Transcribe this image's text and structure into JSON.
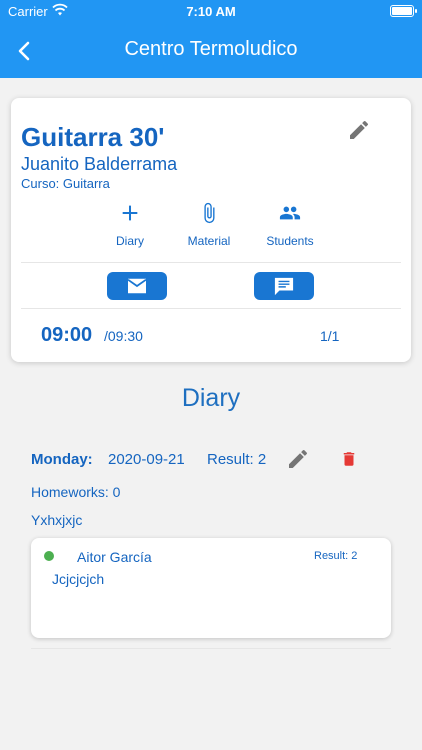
{
  "status_bar": {
    "carrier": "Carrier",
    "time": "7:10 AM"
  },
  "app_bar": {
    "title": "Centro Termoludico",
    "back_icon": "arrow-back-icon"
  },
  "class_card": {
    "title": "Guitarra 30'",
    "teacher": "Juanito Balderrama",
    "course": "Curso: Guitarra",
    "actions": [
      {
        "label": "Diary",
        "icon": "add-icon"
      },
      {
        "label": "Material",
        "icon": "paperclip-icon"
      },
      {
        "label": "Students",
        "icon": "group-icon"
      }
    ],
    "buttons": [
      {
        "icon": "email-icon"
      },
      {
        "icon": "message-icon"
      }
    ],
    "start_time": "09:00",
    "end_time": "/09:30",
    "pagination": "1/1"
  },
  "diary": {
    "heading": "Diary",
    "entry": {
      "day": "Monday:",
      "date": "2020-09-21",
      "result": "Result: 2",
      "homeworks": "Homeworks: 0",
      "note": "Yxhxjxjc",
      "student": {
        "name": "Aitor García",
        "result": "Result: 2",
        "note": "Jcjcjcjch",
        "status_color": "#4caf50"
      }
    }
  },
  "colors": {
    "primary": "#2196f3",
    "text": "#1565c0",
    "button": "#1976d2",
    "delete": "#e53935",
    "edit": "#757575"
  }
}
